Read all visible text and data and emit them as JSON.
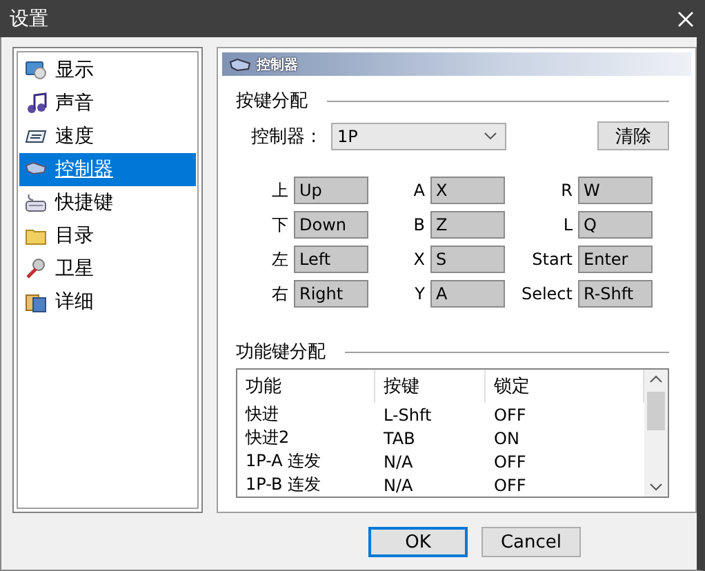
{
  "window": {
    "title": "设置"
  },
  "sidebar": {
    "items": [
      {
        "label": "显示",
        "selected": false
      },
      {
        "label": "声音",
        "selected": false
      },
      {
        "label": "速度",
        "selected": false
      },
      {
        "label": "控制器",
        "selected": true
      },
      {
        "label": "快捷键",
        "selected": false
      },
      {
        "label": "目录",
        "selected": false
      },
      {
        "label": "卫星",
        "selected": false
      },
      {
        "label": "详细",
        "selected": false
      }
    ]
  },
  "panel": {
    "title": "控制器",
    "key_section": {
      "heading": "按键分配",
      "controller_label": "控制器 :",
      "controller_value": "1P",
      "clear_button": "清除",
      "bindings": [
        {
          "label": "上",
          "value": "Up"
        },
        {
          "label": "A",
          "value": "X"
        },
        {
          "label": "R",
          "value": "W"
        },
        {
          "label": "下",
          "value": "Down"
        },
        {
          "label": "B",
          "value": "Z"
        },
        {
          "label": "L",
          "value": "Q"
        },
        {
          "label": "左",
          "value": "Left"
        },
        {
          "label": "X",
          "value": "S"
        },
        {
          "label": "Start",
          "value": "Enter"
        },
        {
          "label": "右",
          "value": "Right"
        },
        {
          "label": "Y",
          "value": "A"
        },
        {
          "label": "Select",
          "value": "R-Shft"
        }
      ]
    },
    "function_section": {
      "heading": "功能键分配",
      "columns": [
        "功能",
        "按键",
        "锁定"
      ],
      "rows": [
        [
          "快进",
          "L-Shft",
          "OFF"
        ],
        [
          "快进2",
          "TAB",
          "ON"
        ],
        [
          "1P-A 连发",
          "N/A",
          "OFF"
        ],
        [
          "1P-B 连发",
          "N/A",
          "OFF"
        ]
      ]
    }
  },
  "buttons": [
    {
      "label": "OK",
      "focused": true
    },
    {
      "label": "Cancel",
      "focused": false
    }
  ]
}
